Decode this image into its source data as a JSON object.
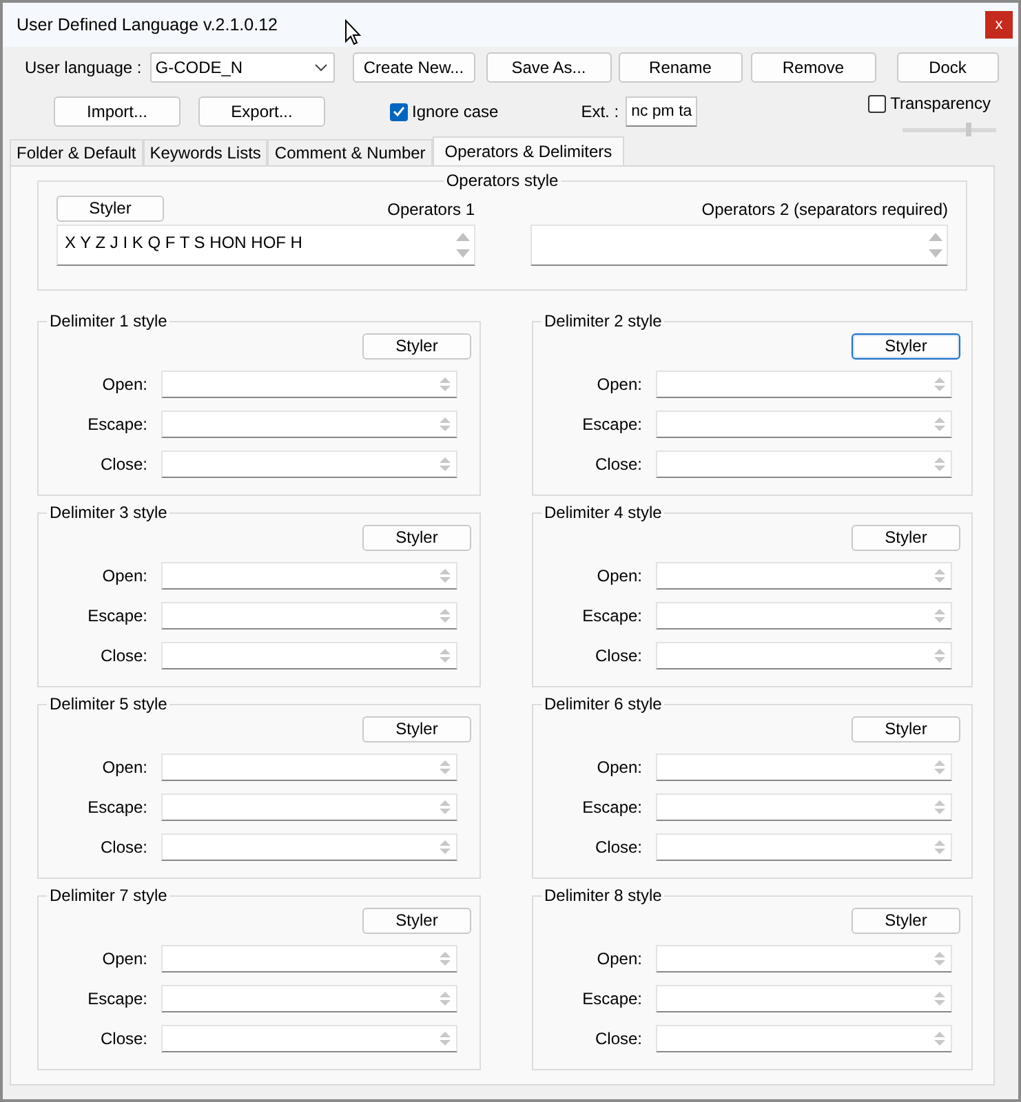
{
  "window": {
    "title": "User Defined Language v.2.1.0.12",
    "close": "x"
  },
  "toolbar": {
    "language_label": "User language :",
    "language": "G-CODE_N",
    "buttons": [
      "Create New...",
      "Save As...",
      "Rename",
      "Remove",
      "Dock"
    ],
    "buttons2": [
      "Import...",
      "Export..."
    ],
    "ignore_case": {
      "label": "Ignore case",
      "checked": true
    },
    "ext_label": "Ext. :",
    "ext": "nc pm ta",
    "transparency": {
      "label": "Transparency",
      "checked": false,
      "level": 0.7
    }
  },
  "tabs": [
    {
      "label": "Folder & Default",
      "selected": false
    },
    {
      "label": "Keywords Lists",
      "selected": false
    },
    {
      "label": "Comment & Number",
      "selected": false
    },
    {
      "label": "Operators & Delimiters",
      "selected": true
    }
  ],
  "operators": {
    "title": "Operators style",
    "styler": "Styler",
    "op1_label": "Operators 1",
    "op1": "X Y Z J I K Q F T S HON HOF H",
    "op2_label": "Operators 2 (separators required)"
  },
  "delimiters": [
    {
      "title": "Delimiter 1 style",
      "styler": "Styler",
      "focused": false,
      "fields": [
        "Open:",
        "Escape:",
        "Close:"
      ]
    },
    {
      "title": "Delimiter 2 style",
      "styler": "Styler",
      "focused": true,
      "fields": [
        "Open:",
        "Escape:",
        "Close:"
      ]
    },
    {
      "title": "Delimiter 3 style",
      "styler": "Styler",
      "focused": false,
      "fields": [
        "Open:",
        "Escape:",
        "Close:"
      ]
    },
    {
      "title": "Delimiter 4 style",
      "styler": "Styler",
      "focused": false,
      "fields": [
        "Open:",
        "Escape:",
        "Close:"
      ]
    },
    {
      "title": "Delimiter 5 style",
      "styler": "Styler",
      "focused": false,
      "fields": [
        "Open:",
        "Escape:",
        "Close:"
      ]
    },
    {
      "title": "Delimiter 6 style",
      "styler": "Styler",
      "focused": false,
      "fields": [
        "Open:",
        "Escape:",
        "Close:"
      ]
    },
    {
      "title": "Delimiter 7 style",
      "styler": "Styler",
      "focused": false,
      "fields": [
        "Open:",
        "Escape:",
        "Close:"
      ]
    },
    {
      "title": "Delimiter 8 style",
      "styler": "Styler",
      "focused": false,
      "fields": [
        "Open:",
        "Escape:",
        "Close:"
      ]
    }
  ]
}
